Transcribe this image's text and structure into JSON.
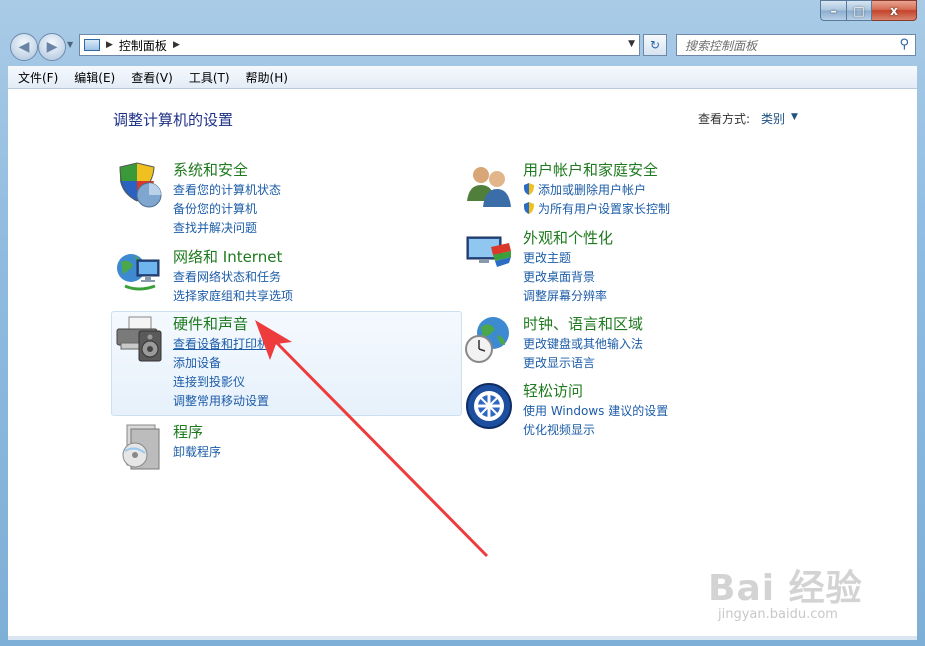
{
  "window": {
    "minimize_label": "–",
    "maximize_label": "□",
    "close_label": "x"
  },
  "nav": {
    "address_path": "控制面板",
    "search_placeholder": "搜索控制面板"
  },
  "menu": [
    "文件(F)",
    "编辑(E)",
    "查看(V)",
    "工具(T)",
    "帮助(H)"
  ],
  "content": {
    "title": "调整计算机的设置",
    "view_by_label": "查看方式:",
    "view_by_value": "类别"
  },
  "categories": [
    {
      "title": "系统和安全",
      "icon": "shield-icon",
      "links": [
        "查看您的计算机状态",
        "备份您的计算机",
        "查找并解决问题"
      ]
    },
    {
      "title": "网络和 Internet",
      "icon": "network-icon",
      "links": [
        "查看网络状态和任务",
        "选择家庭组和共享选项"
      ]
    },
    {
      "title": "硬件和声音",
      "icon": "printer-icon",
      "links": [
        "查看设备和打印机",
        "添加设备",
        "连接到投影仪",
        "调整常用移动设置"
      ]
    },
    {
      "title": "程序",
      "icon": "programs-icon",
      "links": [
        "卸载程序"
      ]
    },
    {
      "title": "用户帐户和家庭安全",
      "icon": "users-icon",
      "links": [
        "添加或删除用户帐户",
        "为所有用户设置家长控制"
      ]
    },
    {
      "title": "外观和个性化",
      "icon": "appearance-icon",
      "links": [
        "更改主题",
        "更改桌面背景",
        "调整屏幕分辨率"
      ]
    },
    {
      "title": "时钟、语言和区域",
      "icon": "clock-globe-icon",
      "links": [
        "更改键盘或其他输入法",
        "更改显示语言"
      ]
    },
    {
      "title": "轻松访问",
      "icon": "ease-of-access-icon",
      "links": [
        "使用 Windows 建议的设置",
        "优化视频显示"
      ]
    }
  ],
  "watermark": {
    "main": "Bai 经验",
    "sub": "jingyan.baidu.com"
  },
  "colors": {
    "category_title": "#1e7a1e",
    "link": "#1c5ca8",
    "page_title": "#1e3287",
    "annotation_arrow": "#ee3b3b"
  }
}
